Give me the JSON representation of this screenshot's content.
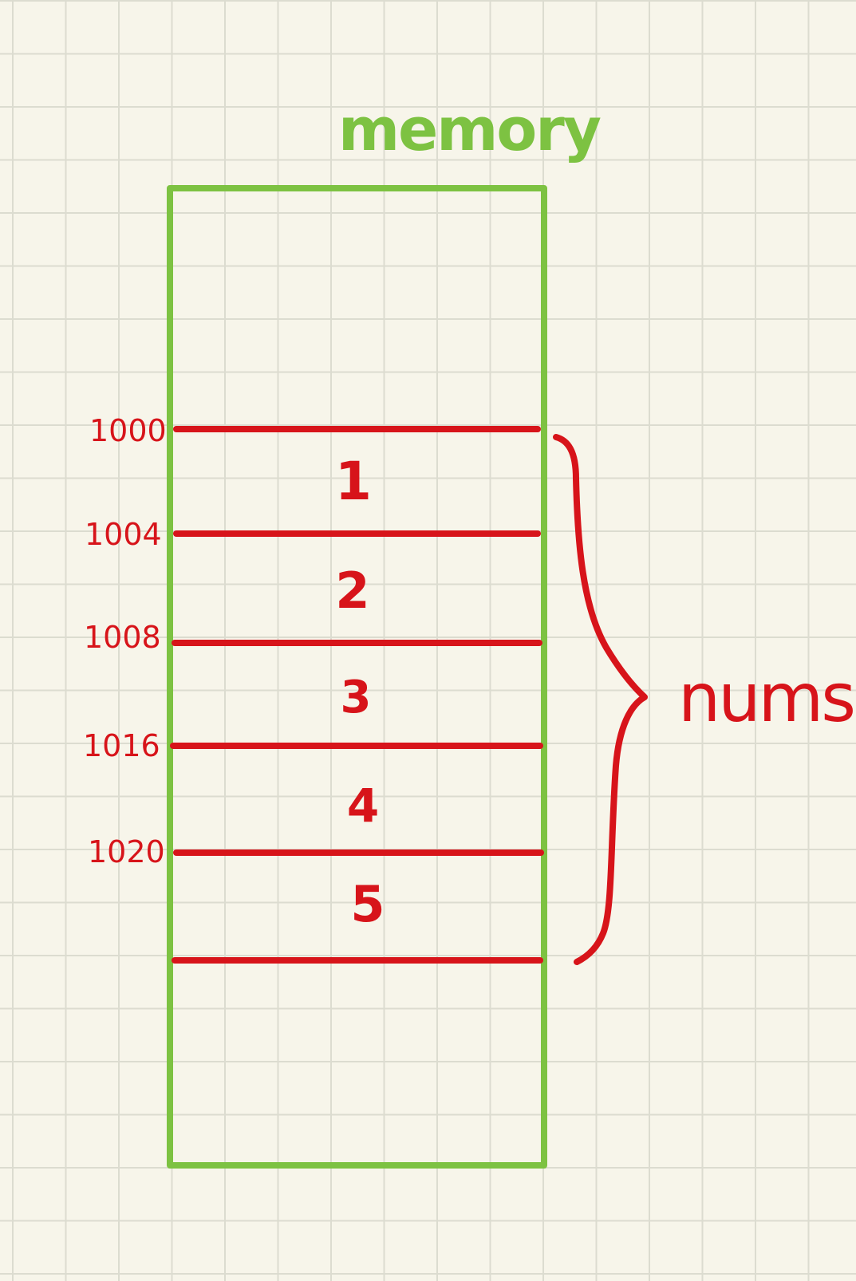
{
  "title": "memory",
  "group_label": "nums",
  "addresses": [
    "1000",
    "1004",
    "1008",
    "1016",
    "1020"
  ],
  "cells": [
    "1",
    "2",
    "3",
    "4",
    "5"
  ],
  "colors": {
    "background": "#f7f5ea",
    "grid": "#dcdcd0",
    "memory_box": "#7dc242",
    "array": "#d7141a"
  }
}
